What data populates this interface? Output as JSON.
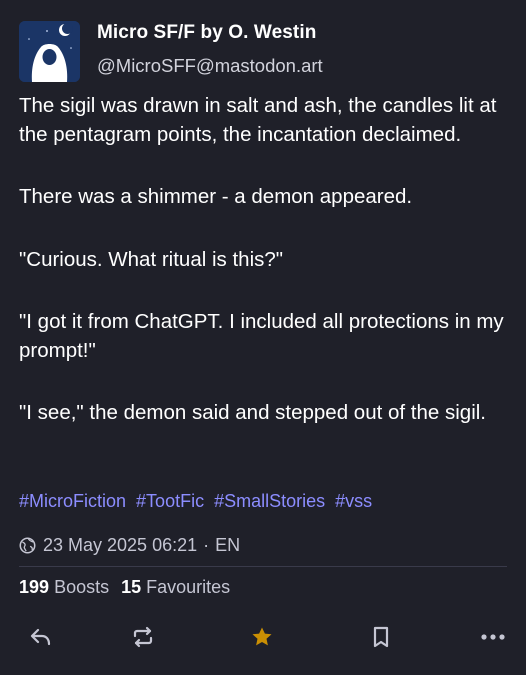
{
  "account": {
    "display_name": "Micro SF/F by O. Westin",
    "handle": "@MicroSFF@mastodon.art",
    "avatar_icon": "moon-hooded-figure-avatar"
  },
  "post": {
    "paragraphs": [
      "The sigil was drawn in salt and ash, the candles lit at the pentagram points, the incantation declaimed.",
      "There was a shimmer - a demon appeared.",
      "\"Curious. What ritual is this?\"",
      "\"I got it from ChatGPT. I included all protections in my prompt!\"",
      "\"I see,\" the demon said and stepped out of the sigil."
    ],
    "hashtags": [
      "#MicroFiction",
      "#TootFic",
      "#SmallStories",
      "#vss"
    ],
    "visibility_icon": "globe-icon",
    "date": "23 May 2025 06:21",
    "separator": "·",
    "language": "EN"
  },
  "stats": {
    "boosts_count": "199",
    "boosts_label": "Boosts",
    "favourites_count": "15",
    "favourites_label": "Favourites"
  },
  "actions": [
    "reply-icon",
    "boost-icon",
    "favourite-icon",
    "bookmark-icon",
    "more-icon"
  ],
  "colors": {
    "background": "#1f2029",
    "hashtag": "#8c8dff",
    "favourite_active": "#ca8f04",
    "muted_text": "#c5c6d3"
  }
}
